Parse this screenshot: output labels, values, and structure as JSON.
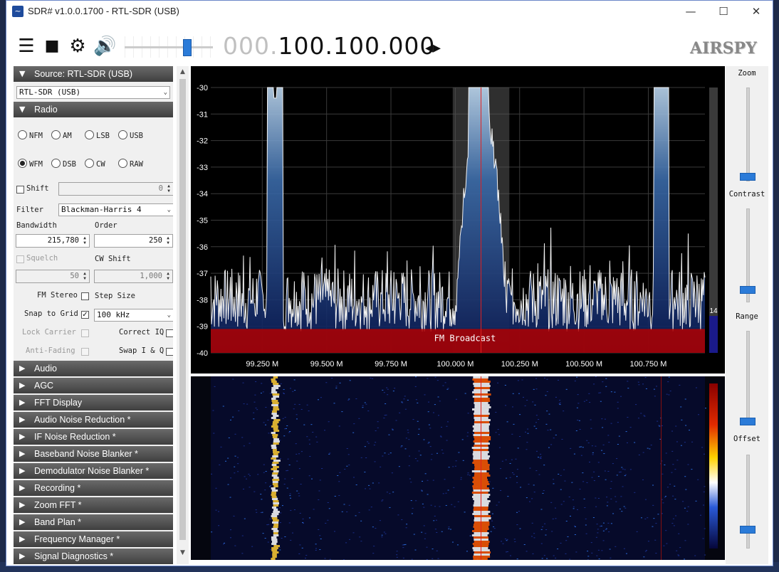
{
  "window": {
    "title": "SDR# v1.0.0.1700 - RTL-SDR (USB)",
    "minimize": "—",
    "maximize": "☐",
    "close": "✕"
  },
  "toolbar": {
    "frequency_dim": "000.",
    "frequency_main": "100.100.000",
    "freq_arrows": "◂▸",
    "logo": "AIRSPY",
    "volume_fraction": 0.72
  },
  "panel": {
    "source_header": "Source: RTL-SDR (USB)",
    "device": "RTL-SDR (USB)",
    "radio_header": "Radio",
    "modes": [
      {
        "label": "NFM",
        "selected": false
      },
      {
        "label": "AM",
        "selected": false
      },
      {
        "label": "LSB",
        "selected": false
      },
      {
        "label": "USB",
        "selected": false
      },
      {
        "label": "WFM",
        "selected": true
      },
      {
        "label": "DSB",
        "selected": false
      },
      {
        "label": "CW",
        "selected": false
      },
      {
        "label": "RAW",
        "selected": false
      }
    ],
    "shift_label": "Shift",
    "shift_value": "0",
    "filter_label": "Filter",
    "filter_value": "Blackman-Harris 4",
    "bandwidth_label": "Bandwidth",
    "bandwidth_value": "215,780",
    "order_label": "Order",
    "order_value": "250",
    "squelch_label": "Squelch",
    "squelch_value": "50",
    "cwshift_label": "CW Shift",
    "cwshift_value": "1,000",
    "fm_stereo_label": "FM Stereo",
    "step_size_label": "Step Size",
    "snap_label": "Snap to Grid",
    "step_value": "100 kHz",
    "lock_carrier_label": "Lock Carrier",
    "correct_iq_label": "Correct IQ",
    "anti_fading_label": "Anti-Fading",
    "swap_iq_label": "Swap I & Q",
    "collapsed": [
      "Audio",
      "AGC",
      "FFT Display",
      "Audio Noise Reduction *",
      "IF Noise Reduction *",
      "Baseband Noise Blanker *",
      "Demodulator Noise Blanker *",
      "Recording *",
      "Zoom FFT *",
      "Band Plan *",
      "Frequency Manager *",
      "Signal Diagnostics *"
    ]
  },
  "right_panel": {
    "zoom": "Zoom",
    "contrast": "Contrast",
    "range": "Range",
    "offset": "Offset"
  },
  "chart_data": {
    "type": "line",
    "title": "",
    "xlabel": "",
    "ylabel": "",
    "x_unit": "MHz",
    "xlim": [
      99.05,
      100.97
    ],
    "ylim": [
      -40,
      -30
    ],
    "x_ticks": [
      99.25,
      99.5,
      99.75,
      100.0,
      100.25,
      100.5,
      100.75
    ],
    "x_tick_labels": [
      "99.250 M",
      "99.500 M",
      "99.750 M",
      "100.000 M",
      "100.250 M",
      "100.500 M",
      "100.750 M"
    ],
    "y_ticks": [
      -30,
      -31,
      -32,
      -33,
      -34,
      -35,
      -36,
      -37,
      -38,
      -39,
      -40
    ],
    "noise_floor": -38,
    "peaks": [
      {
        "x": 99.3,
        "y": -30.4
      },
      {
        "x": 100.08,
        "y": -30.0
      },
      {
        "x": 100.1,
        "y": -30.2
      },
      {
        "x": 100.8,
        "y": -30.0
      }
    ],
    "tuned_frequency": 100.1,
    "filter_band": [
      99.99,
      100.21
    ],
    "band_label": "FM Broadcast",
    "level_value": "14"
  }
}
